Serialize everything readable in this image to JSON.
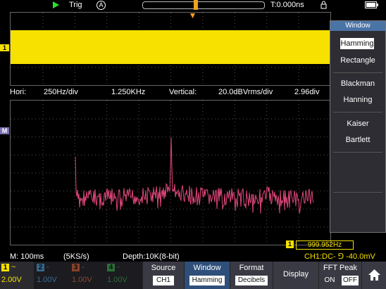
{
  "topbar": {
    "trigger_label": "Trig",
    "trigger_mode": "A",
    "time_offset": "T:0.000ns"
  },
  "info": {
    "hori_label": "Hori:",
    "hori_scale": "250Hz/div",
    "center_freq": "1.250KHz",
    "vertical_label": "Vertical:",
    "vertical_scale": "20.0dBVrms/div",
    "vertical_offset": "2.96div"
  },
  "markers": {
    "ch1": "1",
    "math": "M"
  },
  "status": {
    "timebase": "M: 100ms",
    "sample_rate": "(5KS/s)",
    "depth": "Depth:10K(8-bit)",
    "freq_counter_ch": "1",
    "freq_counter": "999.952Hz",
    "trigger_info": "CH1:DC- ⅁ -40.0mV"
  },
  "menu": {
    "title": "Window",
    "options": [
      "Hamming",
      "Rectangle",
      "Blackman",
      "Hanning",
      "Kaiser",
      "Bartlett"
    ],
    "selected": "Hamming"
  },
  "channels": [
    {
      "num": "1",
      "coupling": "~",
      "scale": "2.00V",
      "color": "#f6e100"
    },
    {
      "num": "2",
      "coupling": "-",
      "scale": "1.00V",
      "color": "#4aa3e0"
    },
    {
      "num": "3",
      "coupling": "-",
      "scale": "1.00V",
      "color": "#e06030"
    },
    {
      "num": "4",
      "coupling": "-",
      "scale": "1.00V",
      "color": "#3bb34a"
    }
  ],
  "softkeys": {
    "source_label": "Source",
    "source_value": "CH1",
    "window_label": "Window",
    "window_value": "Hamming",
    "format_label": "Format",
    "format_value": "Decibels",
    "display_label": "Display",
    "fftpeak_label": "FFT Peak",
    "fftpeak_on": "ON",
    "fftpeak_off": "OFF"
  },
  "colors": {
    "ch1": "#f6e100",
    "math": "#e0477a",
    "accent": "#4a73a6",
    "marker": "#f0a020"
  },
  "icons": {
    "run": "play-icon",
    "lock": "lock-icon",
    "battery": "battery-icon",
    "home": "home-icon"
  }
}
